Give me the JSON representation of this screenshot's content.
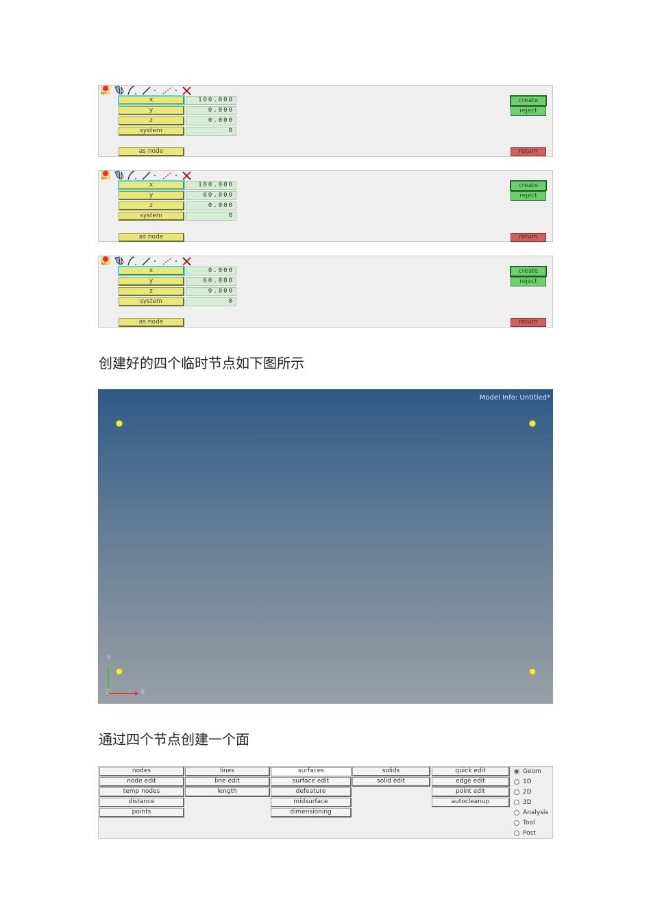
{
  "panels": [
    {
      "fields": [
        {
          "label": "x",
          "value": "100.000"
        },
        {
          "label": "y",
          "value": "0.000"
        },
        {
          "label": "z",
          "value": "0.000"
        },
        {
          "label": "system",
          "value": "0"
        }
      ],
      "as_node": "as node",
      "create": "create",
      "reject": "reject",
      "return": "return"
    },
    {
      "fields": [
        {
          "label": "x",
          "value": "100.000"
        },
        {
          "label": "y",
          "value": "60.000"
        },
        {
          "label": "z",
          "value": "0.000"
        },
        {
          "label": "system",
          "value": "0"
        }
      ],
      "as_node": "as node",
      "create": "create",
      "reject": "reject",
      "return": "return"
    },
    {
      "fields": [
        {
          "label": "x",
          "value": "0.000"
        },
        {
          "label": "y",
          "value": "60.000"
        },
        {
          "label": "z",
          "value": "0.000"
        },
        {
          "label": "system",
          "value": "0"
        }
      ],
      "as_node": "as node",
      "create": "create",
      "reject": "reject",
      "return": "return"
    }
  ],
  "toolbar_icons": [
    "xyz-icon",
    "cursor-icon",
    "curve-icon",
    "line-icon",
    "dashed-line-icon",
    "delete-x-icon"
  ],
  "caption1": "创建好的四个临时节点如下图所示",
  "viewport": {
    "model_info": "Model Info: Untitled*",
    "axis_y": "Y",
    "axis_x": "X",
    "axis_z": "Z",
    "node_color": "#f5ee3a"
  },
  "caption2": "通过四个节点创建一个面",
  "menu": {
    "col1": [
      "nodes",
      "node edit",
      "temp nodes",
      "distance",
      "points"
    ],
    "col2": [
      "lines",
      "line edit",
      "length"
    ],
    "col3": [
      "surfaces",
      "surface edit",
      "defeature",
      "midsurface",
      "dimensioning"
    ],
    "col4": [
      "solids",
      "solid edit"
    ],
    "col5": [
      "quick edit",
      "edge edit",
      "point edit",
      "autocleanup"
    ],
    "radios": [
      {
        "label": "Geom",
        "checked": true
      },
      {
        "label": "1D",
        "checked": false
      },
      {
        "label": "2D",
        "checked": false
      },
      {
        "label": "3D",
        "checked": false
      },
      {
        "label": "Analysis",
        "checked": false
      },
      {
        "label": "Tool",
        "checked": false
      },
      {
        "label": "Post",
        "checked": false
      }
    ]
  },
  "colors": {
    "field_yellow": "#e8e87a",
    "value_green": "#d5ecd5",
    "button_green": "#6fcf6f",
    "button_red": "#d06060",
    "active_outline": "#46d8d8"
  }
}
